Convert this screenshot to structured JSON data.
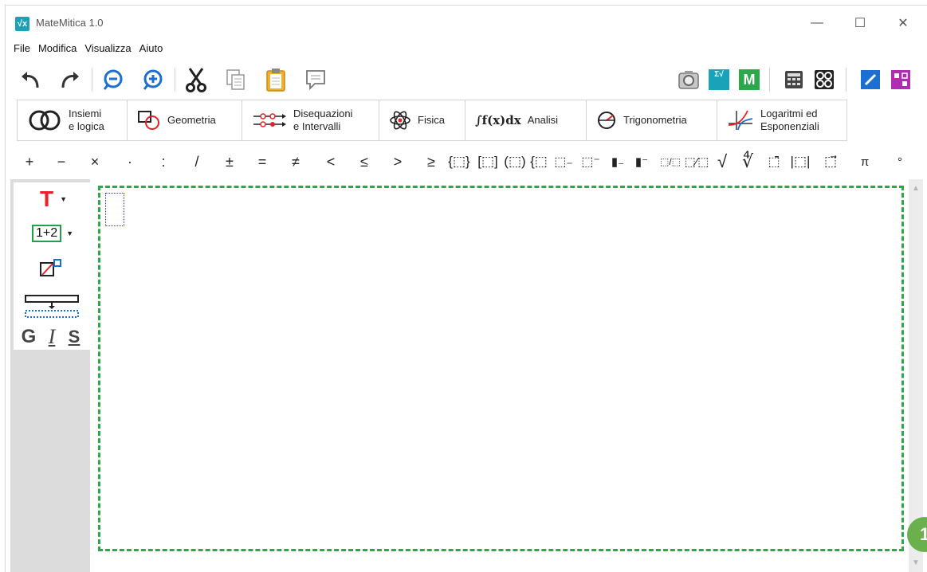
{
  "window": {
    "title": "MateMitica 1.0",
    "app_icon": "√x",
    "controls": {
      "minimize": "—",
      "maximize": "☐",
      "close": "✕"
    }
  },
  "menu": [
    "File",
    "Modifica",
    "Visualizza",
    "Aiuto"
  ],
  "toolbar": {
    "left_icons": [
      "undo-icon",
      "redo-icon",
      "zoom-out-icon",
      "zoom-in-icon",
      "cut-icon",
      "copy-icon",
      "paste-icon",
      "comment-icon"
    ],
    "right_icons": [
      "camera-icon",
      "equation-solver-icon",
      "m-icon",
      "calculator-icon",
      "scientific-calculator-icon",
      "pen-icon",
      "shapes-icon"
    ],
    "m_label": "M",
    "solver_label": "Σ√"
  },
  "tabs": [
    {
      "id": "insiemi",
      "label1": "Insiemi",
      "label2": "e logica"
    },
    {
      "id": "geometria",
      "label1": "Geometria",
      "label2": ""
    },
    {
      "id": "disequazioni",
      "label1": "Disequazioni",
      "label2": "e Intervalli"
    },
    {
      "id": "fisica",
      "label1": "Fisica",
      "label2": ""
    },
    {
      "id": "analisi",
      "label1": "Analisi",
      "label2": "",
      "icon_text": "∫f(x)dx"
    },
    {
      "id": "trigonometria",
      "label1": "Trigonometria",
      "label2": ""
    },
    {
      "id": "logaritmi",
      "label1": "Logaritmi ed",
      "label2": "Esponenziali"
    }
  ],
  "symbols": [
    "+",
    "−",
    "×",
    "·",
    ":",
    "/",
    "±",
    "=",
    "≠",
    "<",
    "≤",
    ">",
    "≥",
    "{⬚}",
    "[⬚]",
    "(⬚)",
    "{⬚",
    "⬚₋",
    "⬚⁻",
    "▮₋",
    "▮⁻",
    "⬚/⬚",
    "⬚⁄⬚",
    "√",
    "∜",
    "⬚̄",
    "|⬚|",
    "⬚⃗",
    "π",
    "°"
  ],
  "left_panel": {
    "text_tool": "T",
    "formula_tool": "1+2",
    "format_bold": "G",
    "format_italic": "I",
    "format_strike": "S"
  },
  "colors": {
    "editor_border": "#2aa84a",
    "text_tool": "#e8202a",
    "formula_border": "#1fa14a",
    "accent_blue": "#1c6fd1",
    "accent_purple": "#b02cb3"
  },
  "badge": "1"
}
